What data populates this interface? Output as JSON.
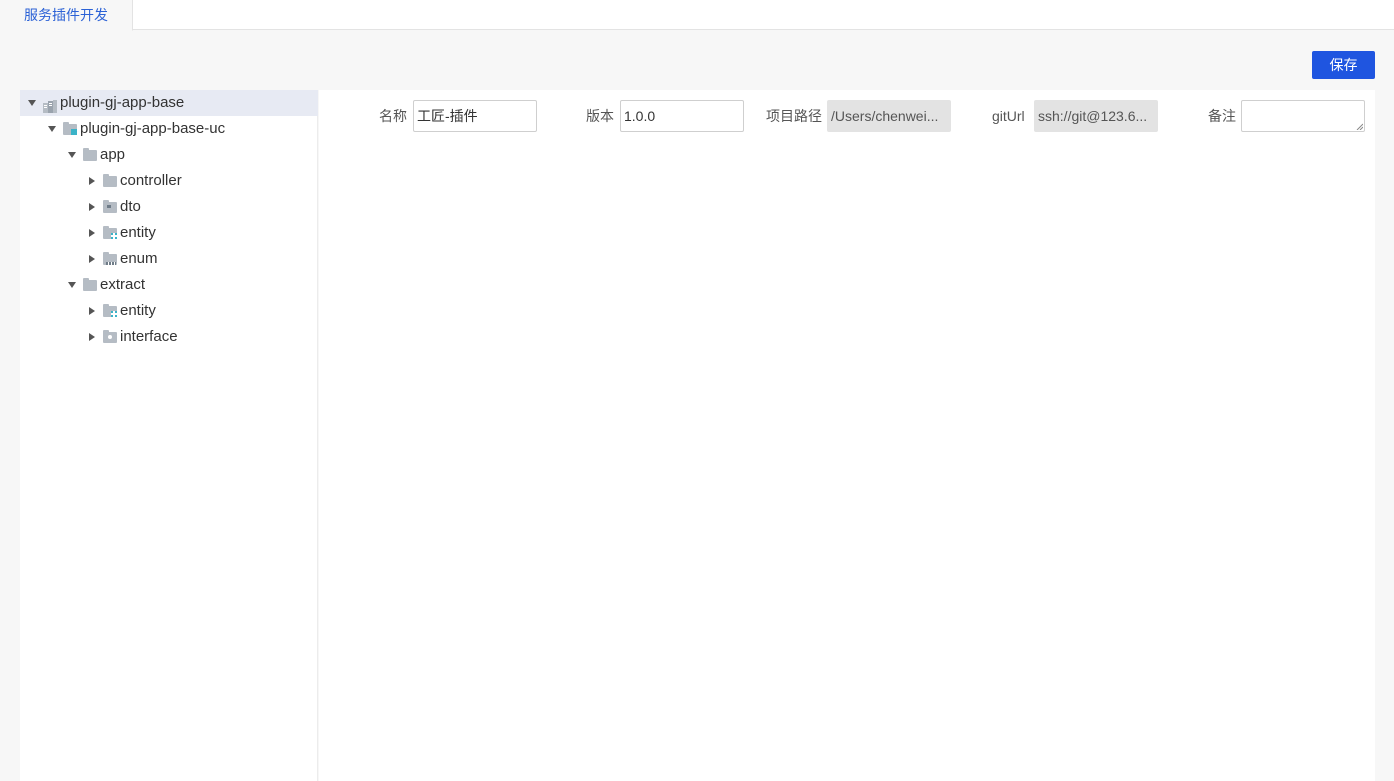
{
  "tabs": [
    {
      "label": "服务插件开发",
      "active": true
    }
  ],
  "toolbar": {
    "save_label": "保存"
  },
  "tree": {
    "items": [
      {
        "label": "plugin-gj-app-base",
        "icon": "project-icon",
        "expanded": true,
        "selected": true
      },
      {
        "label": "plugin-gj-app-base-uc",
        "icon": "module-icon",
        "expanded": true
      },
      {
        "label": "app",
        "icon": "folder-icon",
        "expanded": true
      },
      {
        "label": "controller",
        "icon": "folder-icon",
        "expanded": false
      },
      {
        "label": "dto",
        "icon": "dto-folder-icon",
        "expanded": false
      },
      {
        "label": "entity",
        "icon": "entity-folder-icon",
        "expanded": false
      },
      {
        "label": "enum",
        "icon": "enum-folder-icon",
        "expanded": false
      },
      {
        "label": "extract",
        "icon": "folder-icon",
        "expanded": true
      },
      {
        "label": "entity",
        "icon": "entity-folder-icon",
        "expanded": false
      },
      {
        "label": "interface",
        "icon": "interface-folder-icon",
        "expanded": false
      }
    ]
  },
  "form": {
    "name": {
      "label": "名称",
      "value": "工匠-插件"
    },
    "version": {
      "label": "版本",
      "value": "1.0.0"
    },
    "path": {
      "label": "项目路径",
      "value": "/Users/chenwei..."
    },
    "git": {
      "label": "gitUrl",
      "value": "ssh://git@123.6..."
    },
    "remark": {
      "label": "备注",
      "value": ""
    }
  },
  "colors": {
    "accent": "#1f55e0",
    "tab_active_text": "#2c62d6",
    "selected_row": "#e7eaf3",
    "icon_gray": "#b5bcc4",
    "icon_teal": "#3ab3c8"
  }
}
